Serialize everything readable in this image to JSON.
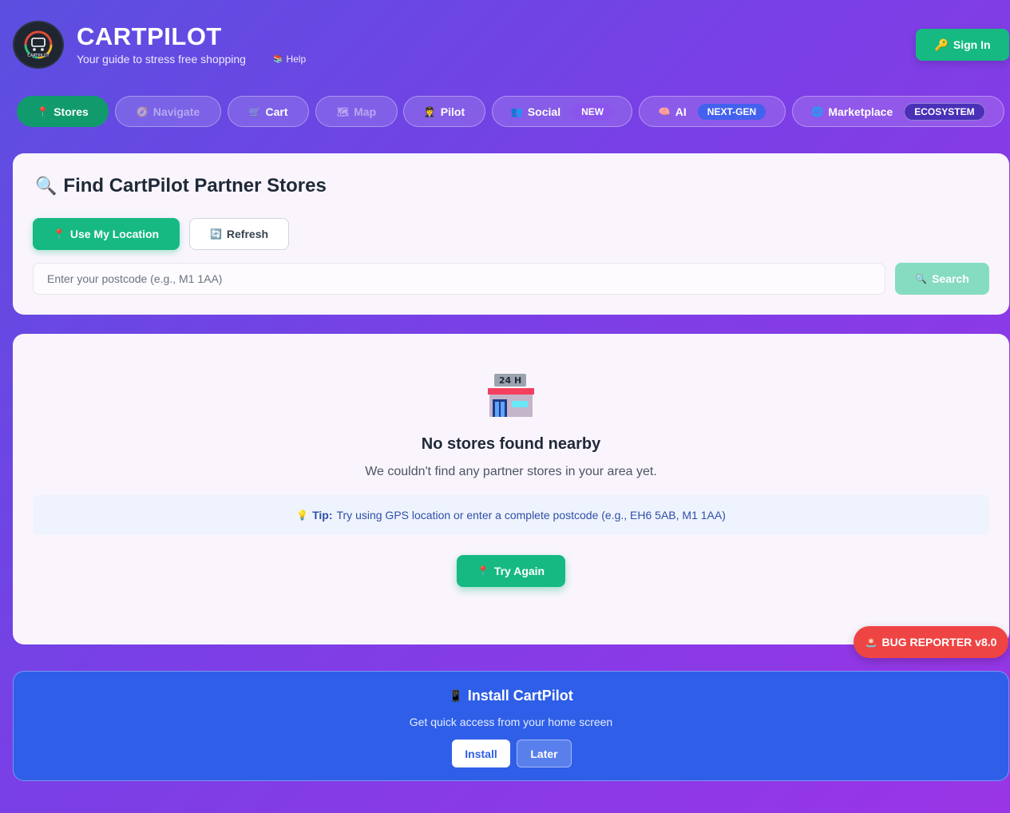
{
  "header": {
    "title": "CARTPILOT",
    "subtitle": "Your guide to stress free shopping",
    "help_label": "Help",
    "sign_in_label": "Sign In"
  },
  "nav": {
    "tabs": [
      {
        "label": "Stores",
        "icon": "pin-icon",
        "active": true
      },
      {
        "label": "Navigate",
        "icon": "compass-icon",
        "disabled": true
      },
      {
        "label": "Cart",
        "icon": "cart-icon"
      },
      {
        "label": "Map",
        "icon": "map-icon",
        "disabled": true
      },
      {
        "label": "Pilot",
        "icon": "pilot-icon"
      },
      {
        "label": "Social",
        "icon": "people-icon",
        "badge": "NEW"
      },
      {
        "label": "AI",
        "icon": "brain-icon",
        "badge": "NEXT-GEN"
      },
      {
        "label": "Marketplace",
        "icon": "globe-icon",
        "badge": "ECOSYSTEM"
      }
    ]
  },
  "finder": {
    "title": "Find CartPilot Partner Stores",
    "use_location_label": "Use My Location",
    "refresh_label": "Refresh",
    "postcode_placeholder": "Enter your postcode (e.g., M1 1AA)",
    "search_label": "Search"
  },
  "empty_state": {
    "icon_text": "24 H",
    "title": "No stores found nearby",
    "subtitle": "We couldn't find any partner stores in your area yet.",
    "tip_label": "Tip:",
    "tip_text": "Try using GPS location or enter a complete postcode (e.g., EH6 5AB, M1 1AA)",
    "try_again_label": "Try Again"
  },
  "bug_reporter": {
    "label": "BUG REPORTER v8.0"
  },
  "install": {
    "title": "Install CartPilot",
    "subtitle": "Get quick access from your home screen",
    "install_label": "Install",
    "later_label": "Later"
  },
  "colors": {
    "accent_green": "#16b981",
    "active_tab": "#119b6d",
    "bug_red": "#ef4444",
    "install_blue": "#2f5fe8"
  }
}
